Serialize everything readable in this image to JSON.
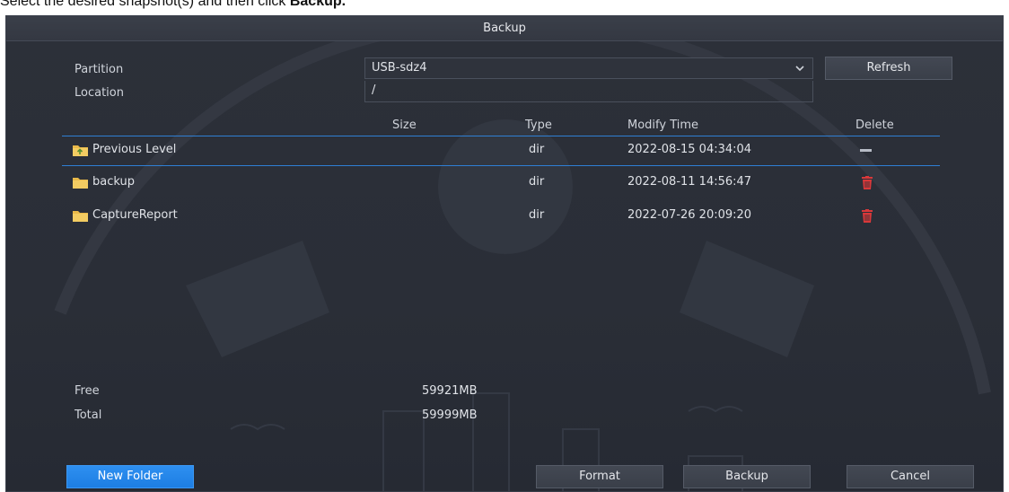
{
  "instruction": {
    "text": "Select the desired snapshot(s) and then click ",
    "emphasis": "Backup."
  },
  "dialog": {
    "title": "Backup",
    "partition_label": "Partition",
    "partition_value": "USB-sdz4",
    "location_label": "Location",
    "location_value": "/",
    "refresh_label": "Refresh",
    "columns": {
      "size": "Size",
      "type": "Type",
      "modify_time": "Modify Time",
      "delete": "Delete"
    },
    "rows": [
      {
        "name": "Previous Level",
        "size": "",
        "type": "dir",
        "modify_time": "2022-08-15 04:34:04",
        "delete": "dash"
      },
      {
        "name": "backup",
        "size": "",
        "type": "dir",
        "modify_time": "2022-08-11 14:56:47",
        "delete": "trash"
      },
      {
        "name": "CaptureReport",
        "size": "",
        "type": "dir",
        "modify_time": "2022-07-26 20:09:20",
        "delete": "trash"
      }
    ],
    "free_label": "Free",
    "free_value": "59921MB",
    "total_label": "Total",
    "total_value": "59999MB",
    "buttons": {
      "new_folder": "New Folder",
      "format": "Format",
      "backup": "Backup",
      "cancel": "Cancel"
    },
    "colors": {
      "accent": "#1d7ee3",
      "delete_icon": "#d9383a",
      "folder_icon": "#e9b949"
    }
  }
}
